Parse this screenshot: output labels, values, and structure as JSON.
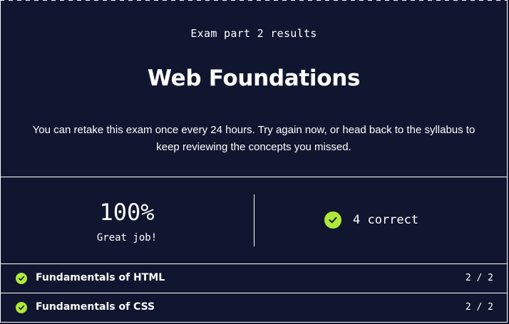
{
  "header": {
    "eyebrow": "Exam part 2 results",
    "title": "Web Foundations",
    "description": "You can retake this exam once every 24 hours. Try again now, or head back to the syllabus to keep reviewing the concepts you missed."
  },
  "score": {
    "percent": "100%",
    "message": "Great job!",
    "correct_text": "4 correct"
  },
  "topics": [
    {
      "name": "Fundamentals of HTML",
      "score": "2 / 2"
    },
    {
      "name": "Fundamentals of CSS",
      "score": "2 / 2"
    }
  ],
  "colors": {
    "background": "#10162f",
    "accent_check": "#aee938",
    "text": "#ffffff"
  },
  "icons": {
    "result_check": "check-circle-icon",
    "topic_check": "check-circle-icon"
  }
}
